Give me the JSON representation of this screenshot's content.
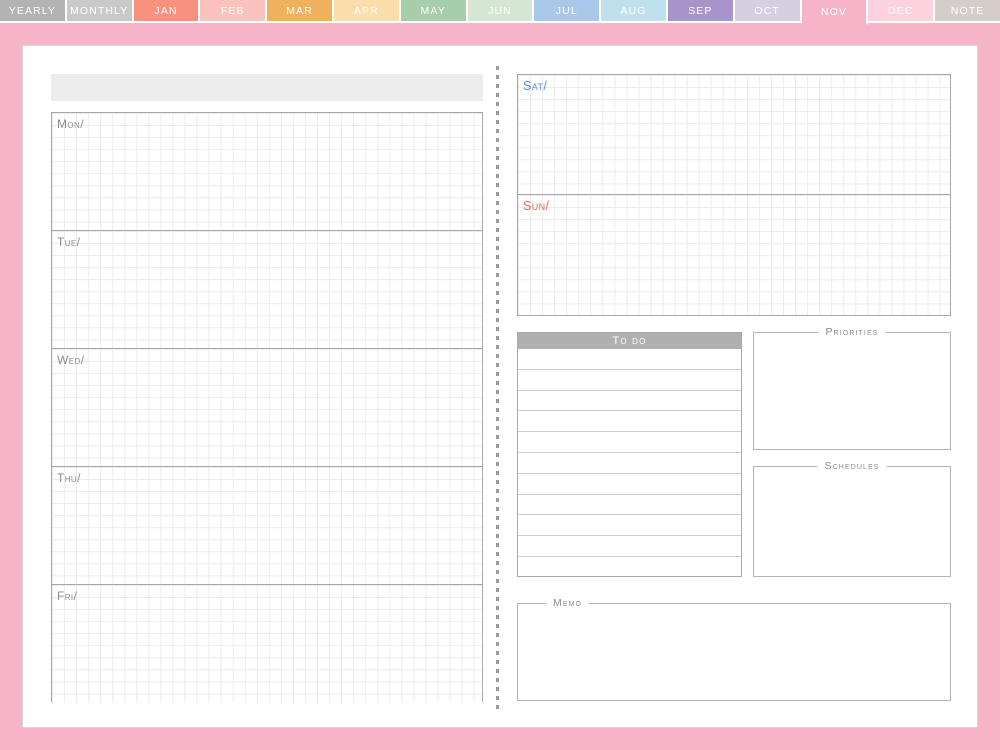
{
  "tabs": [
    {
      "label": "YEARLY",
      "color": "#b3b3b3",
      "active": false
    },
    {
      "label": "MONTHLY",
      "color": "#c9c9c9",
      "active": false
    },
    {
      "label": "JAN",
      "color": "#f9917f",
      "active": false
    },
    {
      "label": "FEB",
      "color": "#fbc3bd",
      "active": false
    },
    {
      "label": "MAR",
      "color": "#f0b15e",
      "active": false
    },
    {
      "label": "APR",
      "color": "#fbdcab",
      "active": false
    },
    {
      "label": "MAY",
      "color": "#a8cdaa",
      "active": false
    },
    {
      "label": "JUN",
      "color": "#d5e7d2",
      "active": false
    },
    {
      "label": "JUL",
      "color": "#a9c7e8",
      "active": false
    },
    {
      "label": "AUG",
      "color": "#bfe0ed",
      "active": false
    },
    {
      "label": "SEP",
      "color": "#a694cb",
      "active": false
    },
    {
      "label": "OCT",
      "color": "#d6cfe2",
      "active": false
    },
    {
      "label": "NOV",
      "color": "#f5b4c8",
      "active": true
    },
    {
      "label": "DEC",
      "color": "#fbd2de",
      "active": false
    },
    {
      "label": "NOTE",
      "color": "#d5cdc9",
      "active": false
    }
  ],
  "page": {
    "frame_color": "#f5b4c8",
    "week_header_value": ""
  },
  "weekdays": [
    {
      "label": "Mon/"
    },
    {
      "label": "Tue/"
    },
    {
      "label": "Wed/"
    },
    {
      "label": "Thu/"
    },
    {
      "label": "Fri/"
    }
  ],
  "weekend": [
    {
      "label": "Sat/",
      "color": "#5b8fd4"
    },
    {
      "label": "Sun/",
      "color": "#e8685a"
    }
  ],
  "todo": {
    "title": "To do",
    "line_count": 11
  },
  "panels": {
    "priorities": "Priorities",
    "schedules": "Schedules",
    "memo": "Memo"
  }
}
